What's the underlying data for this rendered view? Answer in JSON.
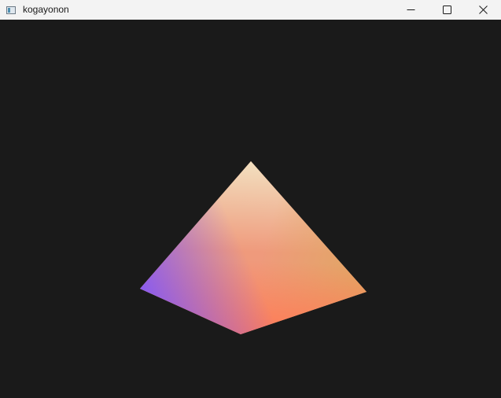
{
  "window": {
    "title": "kogayonon",
    "app_icon": "app-window-icon",
    "controls": {
      "minimize_icon": "minimize-icon",
      "maximize_icon": "maximize-icon",
      "close_icon": "close-icon"
    }
  },
  "viewport": {
    "background": "#1a1a1a",
    "object": "pyramid",
    "vertex_colors": {
      "apex": "#f2e0c0",
      "left": "#8a5cf0",
      "bottom": "#ff7b57",
      "right": "#e0a862"
    }
  }
}
